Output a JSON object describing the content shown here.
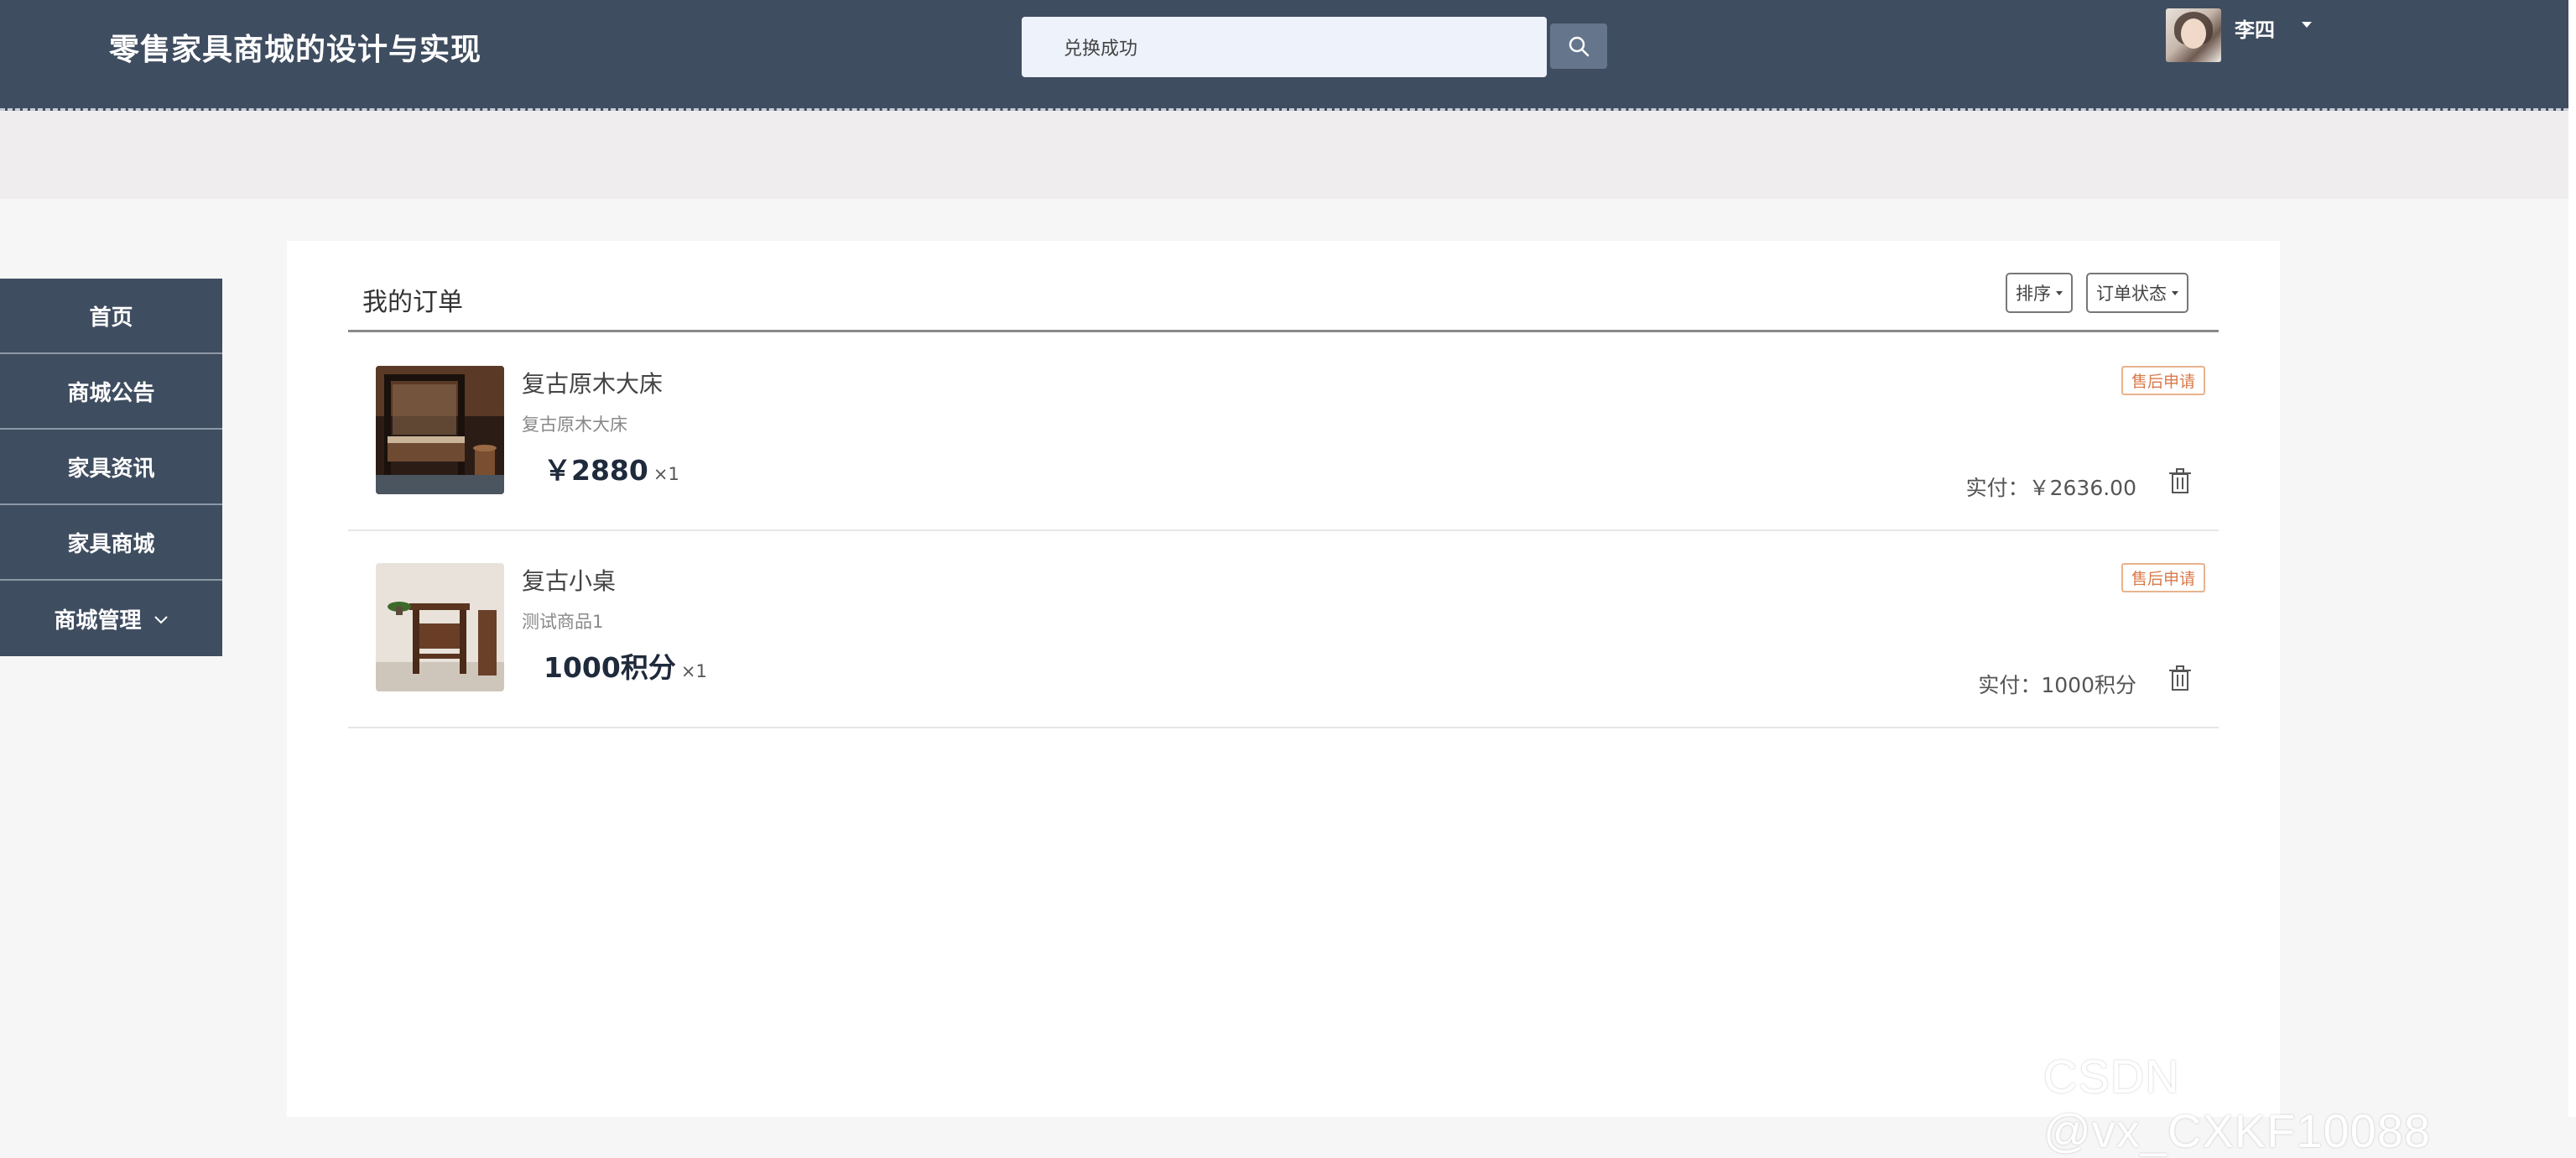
{
  "header": {
    "site_title": "零售家具商城的设计与实现",
    "search": {
      "value": "兑换成功",
      "placeholder": ""
    },
    "search_icon": "search-icon",
    "user": {
      "name": "李四",
      "avatar_icon": "user-avatar"
    }
  },
  "sidebar": {
    "items": [
      {
        "label": "首页"
      },
      {
        "label": "商城公告"
      },
      {
        "label": "家具资讯"
      },
      {
        "label": "家具商城"
      },
      {
        "label": "商城管理",
        "has_submenu": true,
        "icon": "chevron-down-icon"
      }
    ]
  },
  "orders_panel": {
    "title": "我的订单",
    "sort_label": "排序",
    "status_label": "订单状态",
    "orders": [
      {
        "name": "复古原木大床",
        "description": "复古原木大床",
        "price": "￥2880",
        "quantity": "×1",
        "after_sale_label": "售后申请",
        "paid_label": "实付：￥2636.00",
        "delete_icon": "trash-icon"
      },
      {
        "name": "复古小桌",
        "description": "测试商品1",
        "price": "1000积分",
        "quantity": "×1",
        "after_sale_label": "售后申请",
        "paid_label": "实付：1000积分",
        "delete_icon": "trash-icon"
      }
    ]
  },
  "watermark": "CSDN @vx_CXKF10088",
  "colors": {
    "header_bg": "#3f4d60",
    "sidebar_bg": "#3f4d60",
    "badge_border": "#e8b38e",
    "badge_text": "#d9794a"
  }
}
